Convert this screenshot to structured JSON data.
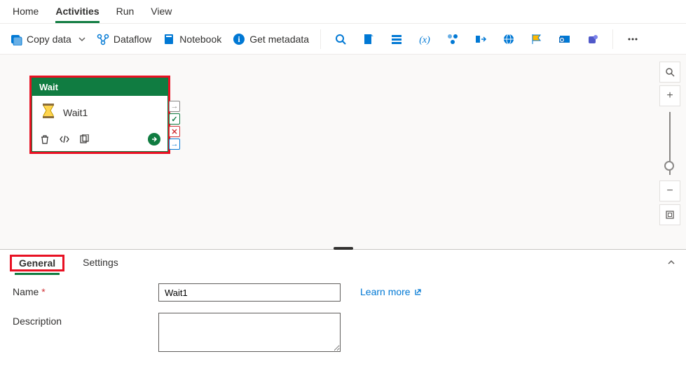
{
  "topTabs": [
    "Home",
    "Activities",
    "Run",
    "View"
  ],
  "topTabActive": "Activities",
  "toolbar": {
    "copyData": "Copy data",
    "dataflow": "Dataflow",
    "notebook": "Notebook",
    "getMetadata": "Get metadata"
  },
  "activity": {
    "type": "Wait",
    "name": "Wait1"
  },
  "panel": {
    "tabs": [
      "General",
      "Settings"
    ],
    "activeTab": "General",
    "nameLabel": "Name",
    "nameValue": "Wait1",
    "descLabel": "Description",
    "descValue": "",
    "learnMore": "Learn more"
  }
}
